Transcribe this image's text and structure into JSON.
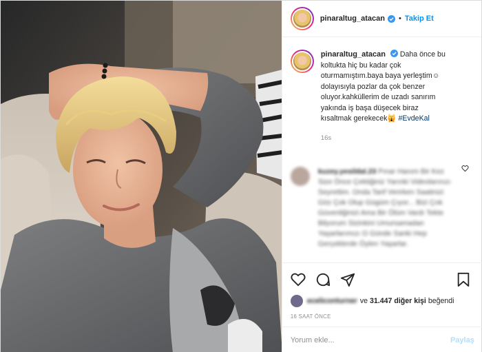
{
  "header": {
    "username": "pinaraltug_atacan",
    "separator": "•",
    "follow_label": "Takip Et"
  },
  "caption": {
    "username": "pinaraltug_atacan",
    "lines": [
      "Daha önce bu",
      "koltukta hiç bu kadar çok",
      "oturmamıştım.baya baya yerleştim☺",
      "dolayısıyla pozlar da çok benzer",
      "oluyor.kahküllerim de uzadı sanırım",
      "yakında iş başa düşecek biraz",
      "kısaltmak gerekecek🙀"
    ],
    "hashtag": "#EvdeKal",
    "time": "16s"
  },
  "comment": {
    "username": "kuzey.yesildal.23",
    "text": "Pınar Hanım Bir Kez Size Önce Çektiğiniz Yarınki Videolarınızı Seyrettim. Onda Tarif Verirken Saatinizi Göz Çok Olup Gügüm Çıyor... Bizi Çok Güvenliğinizi Ama Bir Ölüm Vardı Tekte Bilyorum Sizinkini Umursamadan Yaşarlarımızı O Günde Sanki Hep Gerçeklerde Öylen Yaşarlar."
  },
  "actions": {
    "liked_by_user": "eceliconturner",
    "likes_joiner": "ve",
    "likes_count_text": "31.447 diğer kişi",
    "likes_suffix": "beğendi",
    "ago": "16 SAAT ÖNCE"
  },
  "add_comment": {
    "placeholder": "Yorum ekle...",
    "post_label": "Paylaş"
  },
  "colors": {
    "accent": "#0095f6",
    "verified": "#3897f0",
    "post_disabled": "#b2dffc"
  }
}
